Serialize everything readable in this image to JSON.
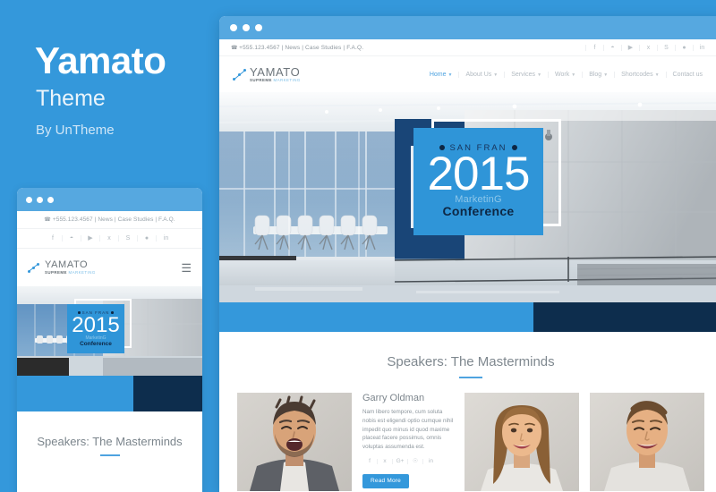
{
  "promo": {
    "title": "Yamato",
    "subtitle": "Theme",
    "author": "By UnTheme",
    "bg_color": "#3498db"
  },
  "site": {
    "topbar": {
      "phone_icon": "phone-icon",
      "text": "+555.123.4567 | News | Case Studies | F.A.Q.",
      "social": [
        {
          "name": "facebook-icon",
          "glyph": "f"
        },
        {
          "name": "rss-icon",
          "glyph": "☳"
        },
        {
          "name": "youtube-icon",
          "glyph": "▶"
        },
        {
          "name": "twitter-icon",
          "glyph": "ᵛ"
        },
        {
          "name": "skype-icon",
          "glyph": "S"
        },
        {
          "name": "dribbble-icon",
          "glyph": "●"
        },
        {
          "name": "linkedin-icon",
          "glyph": "in"
        }
      ]
    },
    "logo": {
      "name": "YAMATO",
      "tagline_bold": "SUPREME",
      "tagline_light": "MARKETING"
    },
    "menu": [
      {
        "label": "Home",
        "caret": true,
        "active": true
      },
      {
        "label": "About Us",
        "caret": true,
        "active": false
      },
      {
        "label": "Services",
        "caret": true,
        "active": false
      },
      {
        "label": "Work",
        "caret": true,
        "active": false
      },
      {
        "label": "Blog",
        "caret": true,
        "active": false
      },
      {
        "label": "Shortcodes",
        "caret": true,
        "active": false
      },
      {
        "label": "Contact us",
        "caret": false,
        "active": false
      }
    ],
    "hero": {
      "location": "SAN FRAN",
      "year": "2015",
      "marketing": "MarketinG",
      "conference": "Conference",
      "badge_color": "#2f95d8",
      "accent_dark": "#0d2744",
      "bar_left_color": "#3498db",
      "bar_right_color": "#0d2d4d"
    },
    "speakers_section": {
      "title": "Speakers: The Masterminds",
      "underline_color": "#4ea3e0",
      "speaker": {
        "name": "Garry Oldman",
        "bio": "Nam libero tempore, cum soluta nobis est eligendi optio cumque nihil impedit quo minus id quod maxime placeat facere possimus, omnis voluptas assumenda est.",
        "social": [
          {
            "name": "facebook-icon",
            "glyph": "f"
          },
          {
            "name": "twitter-icon",
            "glyph": "ᵛ"
          },
          {
            "name": "google-plus-icon",
            "glyph": "G+"
          },
          {
            "name": "pinterest-icon",
            "glyph": "Ⓟ"
          },
          {
            "name": "linkedin-icon",
            "glyph": "in"
          }
        ],
        "button_label": "Read More",
        "button_color": "#3498db"
      }
    },
    "mobile_preview": {
      "topbar_text": "+555.123.4567 | News | Case Studies | F.A.Q.",
      "menu_icon": "hamburger-icon",
      "speakers_title": "Speakers: The Masterminds"
    }
  }
}
